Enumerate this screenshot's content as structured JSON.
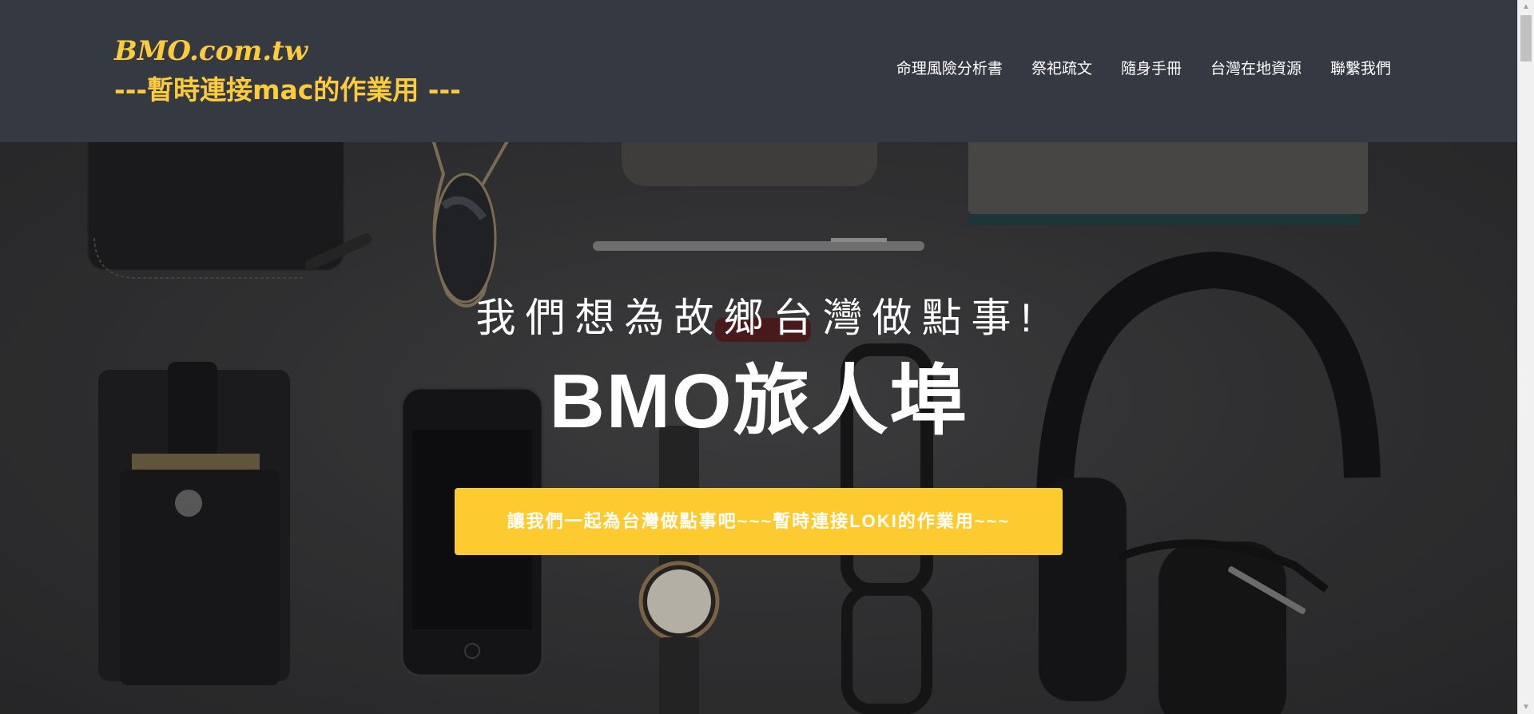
{
  "brand": {
    "line1": "BMO.com.tw",
    "line2": "---暫時連接mac的作業用 ---",
    "color": "#fdcb3c"
  },
  "nav": {
    "items": [
      {
        "label": "命理風險分析書"
      },
      {
        "label": "祭祀疏文"
      },
      {
        "label": "隨身手冊"
      },
      {
        "label": "台灣在地資源"
      },
      {
        "label": "聯繫我們"
      }
    ]
  },
  "hero": {
    "subtitle": "我們想為故鄉台灣做點事!",
    "title": "BMO旅人埠",
    "button_label": "讓我們一起為台灣做點事吧~~~暫時連接LOKI的作業用~~~",
    "button_color": "#fdcb2f"
  },
  "colors": {
    "navbar": "#353a42",
    "accent": "#fdcb3c"
  },
  "icons": {
    "scroll_up": "triangle-up-icon",
    "scroll_down": "triangle-down-icon"
  }
}
